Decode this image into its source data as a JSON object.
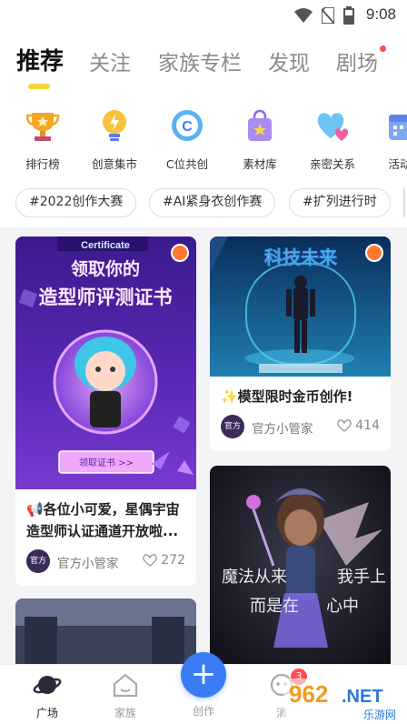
{
  "status_bar": {
    "time": "9:08"
  },
  "top_tabs": [
    {
      "label": "推荐",
      "active": true
    },
    {
      "label": "关注",
      "active": false
    },
    {
      "label": "家族专栏",
      "active": false
    },
    {
      "label": "发现",
      "active": false
    },
    {
      "label": "剧场",
      "active": false
    }
  ],
  "categories": [
    {
      "label": "排行榜",
      "icon": "trophy-icon"
    },
    {
      "label": "创意集市",
      "icon": "lightbulb-icon"
    },
    {
      "label": "C位共创",
      "icon": "c-badge-icon"
    },
    {
      "label": "素材库",
      "icon": "bag-icon"
    },
    {
      "label": "亲密关系",
      "icon": "hearts-icon"
    },
    {
      "label": "活动",
      "icon": "calendar-icon"
    }
  ],
  "chips": [
    "#2022创作大赛",
    "#AI紧身衣创作赛",
    "#扩列进行时"
  ],
  "cards": [
    {
      "image_text_top": "Certificate",
      "image_text_1": "领取你的",
      "image_text_2": "造型师评测证书",
      "image_button": "领取证书 >>",
      "title": "📢各位小可爱，星偶宇宙造型师认证通道开放啦...",
      "author": "官方小管家",
      "avatar_text": "官方",
      "likes": "272"
    },
    {
      "image_text": "科技未来",
      "title": "✨模型限时金币创作!",
      "author": "官方小管家",
      "avatar_text": "官方",
      "likes": "414"
    },
    {
      "image_text_1": "魔法从来",
      "image_text_1b": "我手上",
      "image_text_2": "而是在",
      "image_text_2b": "心中"
    }
  ],
  "bottom_nav": {
    "plaza": "广场",
    "family": "家族",
    "create": "创作",
    "message": "消",
    "badge": "3"
  },
  "watermark": {
    "number": "962",
    "dot_net": ".NET",
    "sub": "乐游网"
  },
  "colors": {
    "accent": "#3a7bf6",
    "tab_underline": "#f5d63b",
    "badge": "#ff4d4f"
  }
}
